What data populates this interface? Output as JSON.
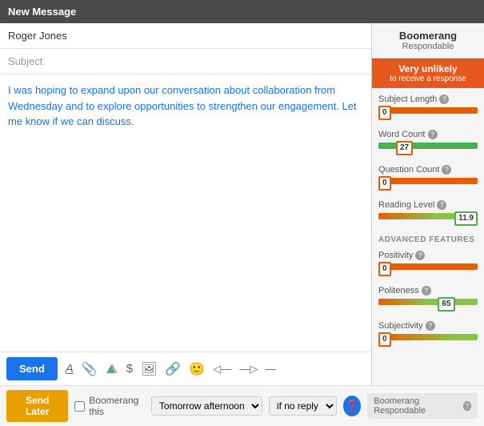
{
  "titlebar": {
    "label": "New Message"
  },
  "compose": {
    "to_value": "Roger Jones",
    "to_placeholder": "Roger Jones",
    "subject_placeholder": "Subject",
    "body_text": "I was hoping to expand upon our conversation about collaboration from Wednesday and to explore opportunities to strengthen our engagement. Let me know if we can discuss."
  },
  "toolbar": {
    "send_label": "Send",
    "icons": [
      "A",
      "📎",
      "△",
      "$",
      "🖼",
      "🔗",
      "😊",
      "◀▬",
      "▬▶",
      "▬"
    ]
  },
  "bottom_bar": {
    "send_later_label": "Send Later",
    "boomerang_label": "Boomerang this",
    "time_option": "Tomorrow afternoon",
    "reply_option": "if no reply",
    "boomerang_respondable": "Boomerang Respondable",
    "help_icon": "?"
  },
  "right_panel": {
    "title": "Boomerang",
    "subtitle": "Respondable",
    "response_badge": "Very unlikely",
    "response_sub": "to receive a response",
    "metrics": [
      {
        "label": "Subject Length",
        "help": "?",
        "value": "0",
        "bar_type": "red",
        "value_pos_pct": 2,
        "badge_color": "orange"
      },
      {
        "label": "Word Count",
        "help": "?",
        "value": "27",
        "bar_type": "green",
        "value_pos_pct": 30,
        "badge_color": "orange"
      },
      {
        "label": "Question Count",
        "help": "?",
        "value": "0",
        "bar_type": "red",
        "value_pos_pct": 2,
        "badge_color": "orange"
      },
      {
        "label": "Reading Level",
        "help": "?",
        "value": "11.9",
        "bar_type": "orange_green",
        "value_pos_pct": 85,
        "badge_color": "green"
      }
    ],
    "advanced_label": "ADVANCED FEATURES",
    "advanced_metrics": [
      {
        "label": "Positivity",
        "help": "?",
        "value": "0",
        "bar_type": "red",
        "value_pos_pct": 2,
        "badge_color": "orange"
      },
      {
        "label": "Politeness",
        "help": "?",
        "value": "65",
        "bar_type": "green",
        "value_pos_pct": 65,
        "badge_color": "green"
      },
      {
        "label": "Subjectivity",
        "help": "?",
        "value": "0",
        "bar_type": "red",
        "value_pos_pct": 2,
        "badge_color": "orange"
      }
    ]
  }
}
